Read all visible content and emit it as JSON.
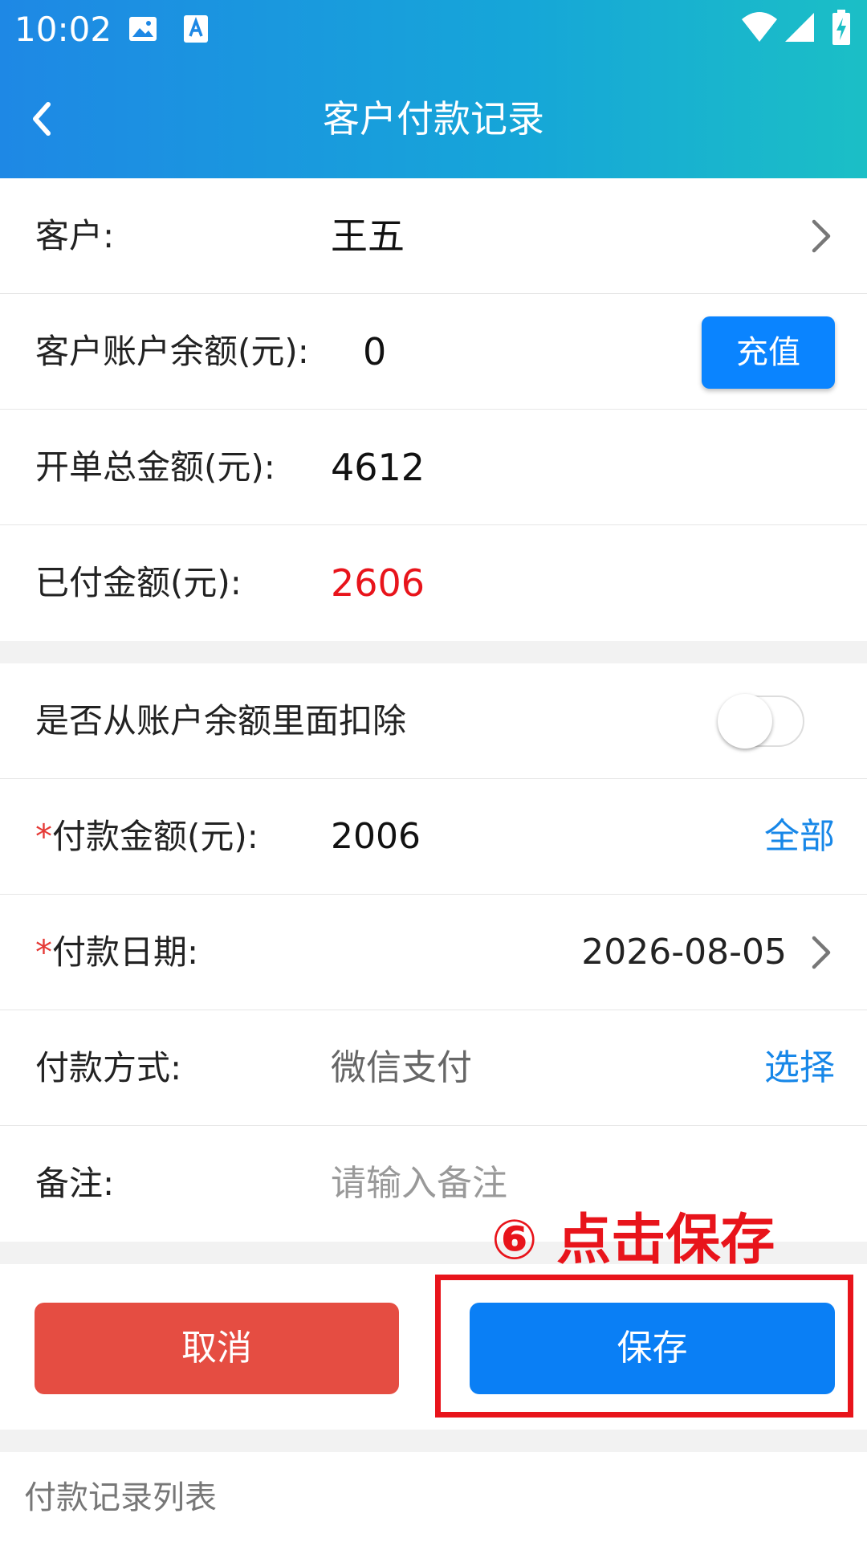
{
  "status_bar": {
    "time": "10:02",
    "icons": [
      "image-icon",
      "font-icon",
      "wifi-icon",
      "signal-icon",
      "battery-charging-icon"
    ]
  },
  "nav": {
    "title": "客户付款记录",
    "back_icon": "chevron-left-icon"
  },
  "info": {
    "customer_label": "客户:",
    "customer_value": "王五",
    "balance_label": "客户账户余额(元):",
    "balance_value": "0",
    "topup_label": "充值",
    "total_label": "开单总金额(元):",
    "total_value": "4612",
    "paid_label": "已付金额(元):",
    "paid_value": "2606"
  },
  "form": {
    "deduct_label": "是否从账户余额里面扣除",
    "deduct_enabled": false,
    "amount_label": "付款金额(元):",
    "amount_value": "2006",
    "amount_all_link": "全部",
    "date_label": "付款日期:",
    "date_value": "2026-08-05",
    "method_label": "付款方式:",
    "method_value": "微信支付",
    "method_select_link": "选择",
    "note_label": "备注:",
    "note_placeholder": "请输入备注",
    "required_mark": "*"
  },
  "actions": {
    "cancel_label": "取消",
    "save_label": "保存"
  },
  "annotation": {
    "text": "⑥ 点击保存"
  },
  "list": {
    "title": "付款记录列表"
  },
  "colors": {
    "header_start": "#1e88e5",
    "header_end": "#1bbfc6",
    "primary": "#0a7ff5",
    "danger": "#e54d42",
    "highlight": "#e8141b",
    "link": "#1787e8"
  }
}
